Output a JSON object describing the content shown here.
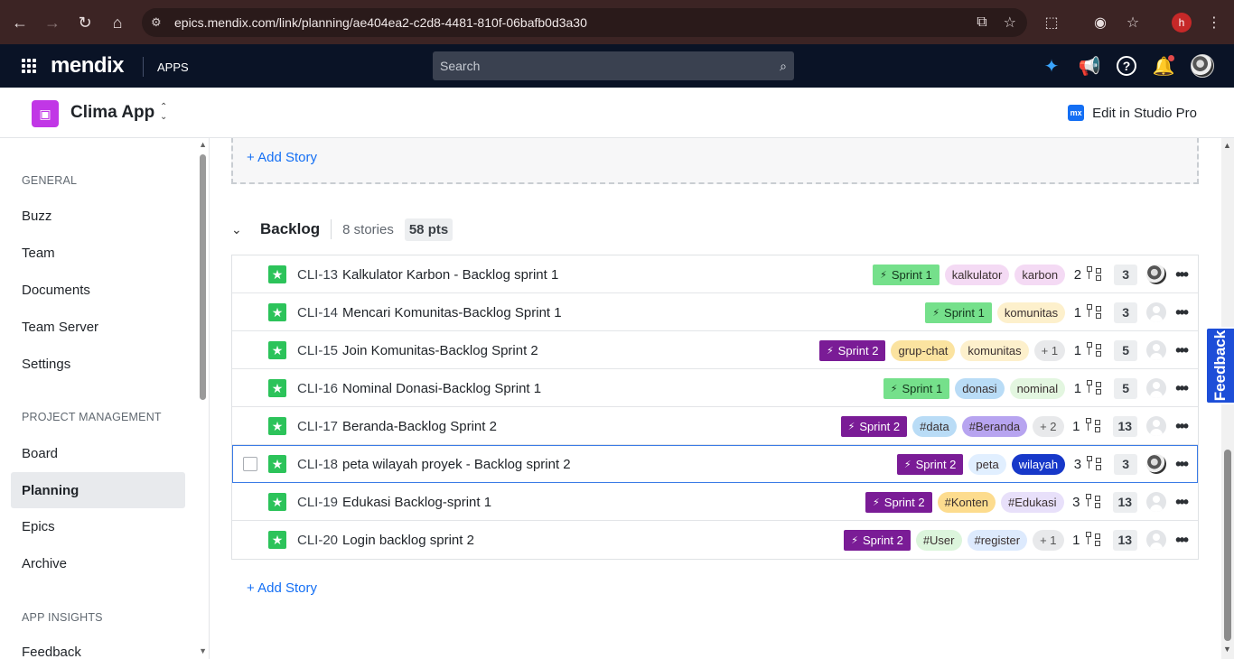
{
  "browser": {
    "url": "epics.mendix.com/link/planning/ae404ea2-c2d8-4481-810f-06bafb0d3a30",
    "profile_initial": "h"
  },
  "topbar": {
    "brand": "mendix",
    "apps_label": "APPS",
    "search_placeholder": "Search"
  },
  "app": {
    "title": "Clima App",
    "studio_label": "Edit in Studio Pro",
    "studio_badge": "mx"
  },
  "sidebar": {
    "general_label": "GENERAL",
    "general_items": [
      "Buzz",
      "Team",
      "Documents",
      "Team Server",
      "Settings"
    ],
    "pm_label": "PROJECT MANAGEMENT",
    "pm_items": [
      "Board",
      "Planning",
      "Epics",
      "Archive"
    ],
    "active_item": "Planning",
    "insights_label": "APP INSIGHTS",
    "insights_items": [
      "Feedback"
    ]
  },
  "main": {
    "add_story_label": "+ Add Story",
    "backlog": {
      "title": "Backlog",
      "count": "8 stories",
      "points": "58 pts"
    },
    "stories": [
      {
        "id": "CLI-13",
        "title": "Kalkulator Karbon - Backlog sprint 1",
        "sprint": "Sprint 1",
        "tags": [
          "kalkulator",
          "karbon"
        ],
        "extra": "",
        "subtasks": "2",
        "points": "3",
        "assignee": "photo"
      },
      {
        "id": "CLI-14",
        "title": "Mencari Komunitas-Backlog Sprint 1",
        "sprint": "Sprint 1",
        "tags": [
          "komunitas"
        ],
        "extra": "",
        "subtasks": "1",
        "points": "3",
        "assignee": "blank"
      },
      {
        "id": "CLI-15",
        "title": "Join Komunitas-Backlog Sprint 2",
        "sprint": "Sprint 2",
        "tags": [
          "grup-chat",
          "komunitas"
        ],
        "extra": "+ 1",
        "subtasks": "1",
        "points": "5",
        "assignee": "blank"
      },
      {
        "id": "CLI-16",
        "title": "Nominal Donasi-Backlog Sprint 1",
        "sprint": "Sprint 1",
        "tags": [
          "donasi",
          "nominal"
        ],
        "extra": "",
        "subtasks": "1",
        "points": "5",
        "assignee": "blank"
      },
      {
        "id": "CLI-17",
        "title": "Beranda-Backlog Sprint 2",
        "sprint": "Sprint 2",
        "tags": [
          "#data",
          "#Beranda"
        ],
        "extra": "+ 2",
        "subtasks": "1",
        "points": "13",
        "assignee": "blank"
      },
      {
        "id": "CLI-18",
        "title": "peta wilayah proyek - Backlog sprint 2",
        "sprint": "Sprint 2",
        "tags": [
          "peta",
          "wilayah"
        ],
        "extra": "",
        "subtasks": "3",
        "points": "3",
        "assignee": "photo"
      },
      {
        "id": "CLI-19",
        "title": "Edukasi Backlog-sprint 1",
        "sprint": "Sprint 2",
        "tags": [
          "#Konten",
          "#Edukasi"
        ],
        "extra": "",
        "subtasks": "3",
        "points": "13",
        "assignee": "blank"
      },
      {
        "id": "CLI-20",
        "title": "Login backlog sprint 2",
        "sprint": "Sprint 2",
        "tags": [
          "#User",
          "#register"
        ],
        "extra": "+ 1",
        "subtasks": "1",
        "points": "13",
        "assignee": "blank"
      }
    ]
  },
  "feedback_tab": "Feedback",
  "colors": {
    "sprint1_bg": "#75e08b",
    "sprint2_bg": "#7a1c96",
    "link": "#146ff4",
    "story_icon": "#2cc35a",
    "tag_kalkulator": "#f4daf4",
    "tag_karbon": "#f4daf4",
    "tag_komunitas": "#fdf0cc",
    "tag_grup-chat": "#fbe3a0",
    "tag_donasi": "#b9dcf6",
    "tag_nominal": "#e3f6e0",
    "tag_#data": "#b9dcf6",
    "tag_#Beranda": "#b7a4f0",
    "tag_peta": "#e1efff",
    "tag_wilayah": "#1738c9",
    "tag_#Konten": "#fddc8e",
    "tag_#Edukasi": "#e8e0fa",
    "tag_#User": "#dcf5dc",
    "tag_#register": "#ddeafd"
  }
}
